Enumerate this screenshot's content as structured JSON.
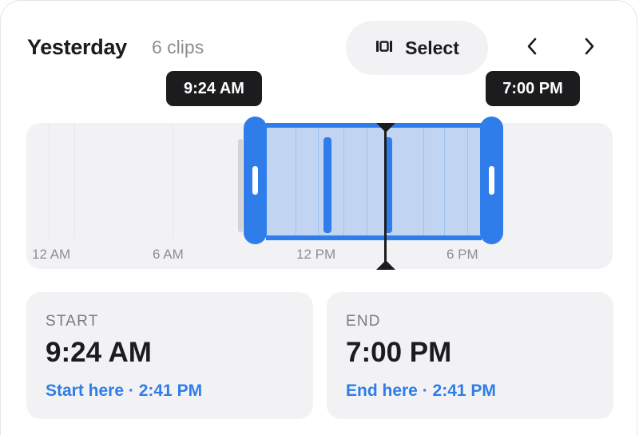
{
  "header": {
    "title": "Yesterday",
    "clip_count": "6 clips",
    "select_label": "Select"
  },
  "timeline": {
    "start_tooltip": "9:24 AM",
    "end_tooltip": "7:00 PM",
    "ticks": [
      "12 AM",
      "6 AM",
      "12 PM",
      "6 PM"
    ]
  },
  "start_panel": {
    "caption": "START",
    "time": "9:24 AM",
    "link": "Start here · 2:41 PM"
  },
  "end_panel": {
    "caption": "END",
    "time": "7:00 PM",
    "link": "End here · 2:41 PM"
  },
  "colors": {
    "accent": "#2e7deb",
    "dark": "#1c1c1e",
    "panel_bg": "#f2f2f4",
    "secondary_text": "#8e8e93"
  }
}
